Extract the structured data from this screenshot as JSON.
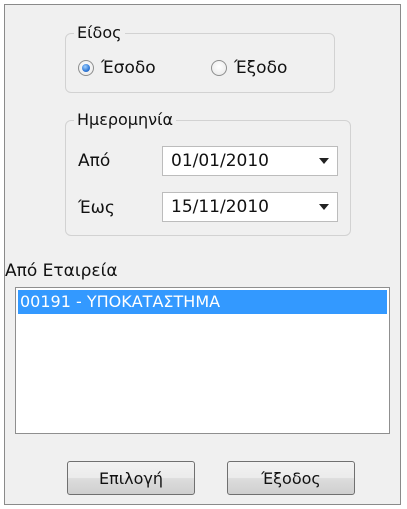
{
  "type_group": {
    "title": "Είδος",
    "options": [
      {
        "label": "Έσοδο",
        "checked": true
      },
      {
        "label": "Έξοδο",
        "checked": false
      }
    ]
  },
  "date_group": {
    "title": "Ημερομηνία",
    "from_label": "Από",
    "from_value": "01/01/2010",
    "to_label": "Έως",
    "to_value": "15/11/2010"
  },
  "company": {
    "label": "Από Εταιρεία",
    "items": [
      {
        "text": "00191 - ΥΠΟΚΑΤΑΣΤΗΜΑ",
        "selected": true
      }
    ]
  },
  "buttons": {
    "select_label": "Επιλογή",
    "exit_label": "Έξοδος"
  }
}
